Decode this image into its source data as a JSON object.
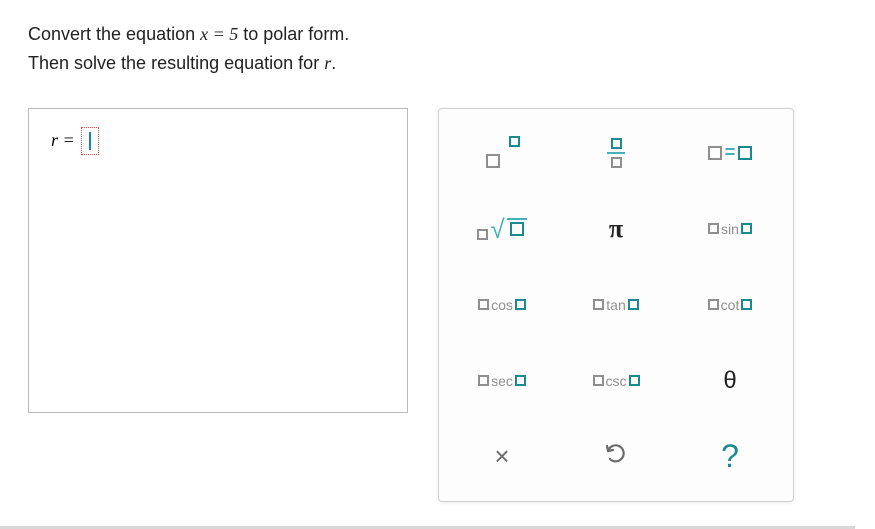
{
  "question": {
    "line1_pre": "Convert the equation ",
    "line1_eq": "x = 5",
    "line1_post": " to polar form.",
    "line2_pre": "Then solve the resulting equation for ",
    "line2_r": "r",
    "line2_post": "."
  },
  "answer": {
    "prefix": "r ="
  },
  "keypad": {
    "power": "power",
    "fraction": "fraction",
    "equals": "=",
    "sqrt": "sqrt",
    "pi": "π",
    "sin": "sin",
    "cos": "cos",
    "tan": "tan",
    "cot": "cot",
    "sec": "sec",
    "csc": "csc",
    "theta": "θ",
    "clear": "×",
    "undo": "↶",
    "help": "?"
  }
}
